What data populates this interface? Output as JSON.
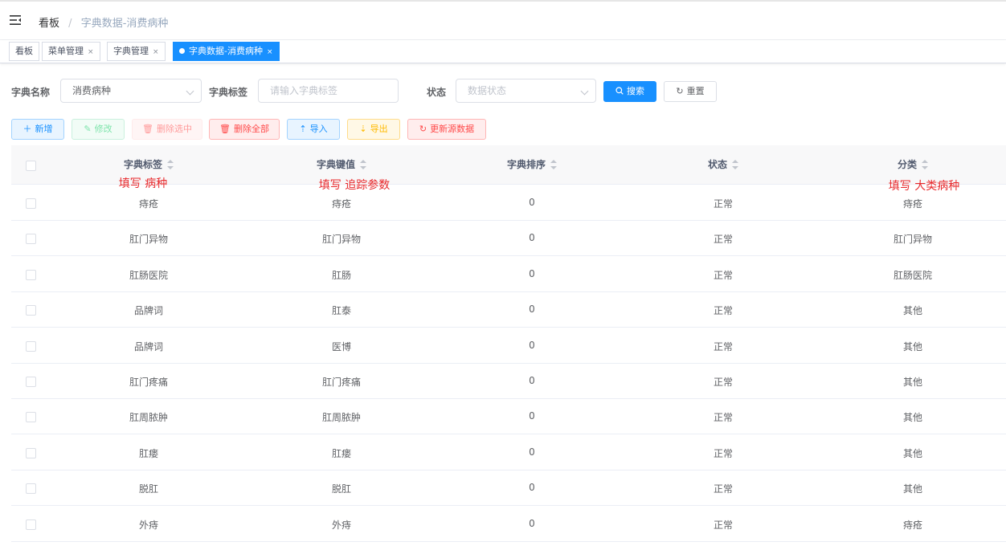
{
  "breadcrumb": {
    "home": "看板",
    "separator": "/",
    "current": "字典数据-消费病种"
  },
  "tabs": [
    {
      "label": "看板",
      "closable": false,
      "active": false
    },
    {
      "label": "菜单管理",
      "closable": true,
      "active": false
    },
    {
      "label": "字典管理",
      "closable": true,
      "active": false
    },
    {
      "label": "字典数据-消费病种",
      "closable": true,
      "active": true
    }
  ],
  "tab_close_glyph": "×",
  "search": {
    "dict_name_label": "字典名称",
    "dict_name_value": "消费病种",
    "dict_label_label": "字典标签",
    "dict_label_placeholder": "请输入字典标签",
    "status_label": "状态",
    "status_placeholder": "数据状态",
    "search_button": "搜索",
    "reset_button": "重置"
  },
  "toolbar": {
    "add": "新增",
    "edit": "修改",
    "delete_selected": "删除选中",
    "delete_all": "删除全部",
    "import": "导入",
    "export": "导出",
    "refresh": "更新源数据"
  },
  "table": {
    "columns": [
      "字典标签",
      "字典键值",
      "字典排序",
      "状态",
      "分类"
    ],
    "rows": [
      [
        "痔疮",
        "痔疮",
        "0",
        "正常",
        "痔疮"
      ],
      [
        "肛门异物",
        "肛门异物",
        "0",
        "正常",
        "肛门异物"
      ],
      [
        "肛肠医院",
        "肛肠",
        "0",
        "正常",
        "肛肠医院"
      ],
      [
        "品牌词",
        "肛泰",
        "0",
        "正常",
        "其他"
      ],
      [
        "品牌词",
        "医博",
        "0",
        "正常",
        "其他"
      ],
      [
        "肛门疼痛",
        "肛门疼痛",
        "0",
        "正常",
        "其他"
      ],
      [
        "肛周脓肿",
        "肛周脓肿",
        "0",
        "正常",
        "其他"
      ],
      [
        "肛瘘",
        "肛瘘",
        "0",
        "正常",
        "其他"
      ],
      [
        "脱肛",
        "脱肛",
        "0",
        "正常",
        "其他"
      ],
      [
        "外痔",
        "外痔",
        "0",
        "正常",
        "痔疮"
      ]
    ]
  },
  "annotations": {
    "label_note": "填写 病种",
    "key_note": "填写 追踪参数",
    "category_note": "填写 大类病种"
  },
  "colors": {
    "primary": "#1890ff",
    "annotation": "#e8282b"
  }
}
